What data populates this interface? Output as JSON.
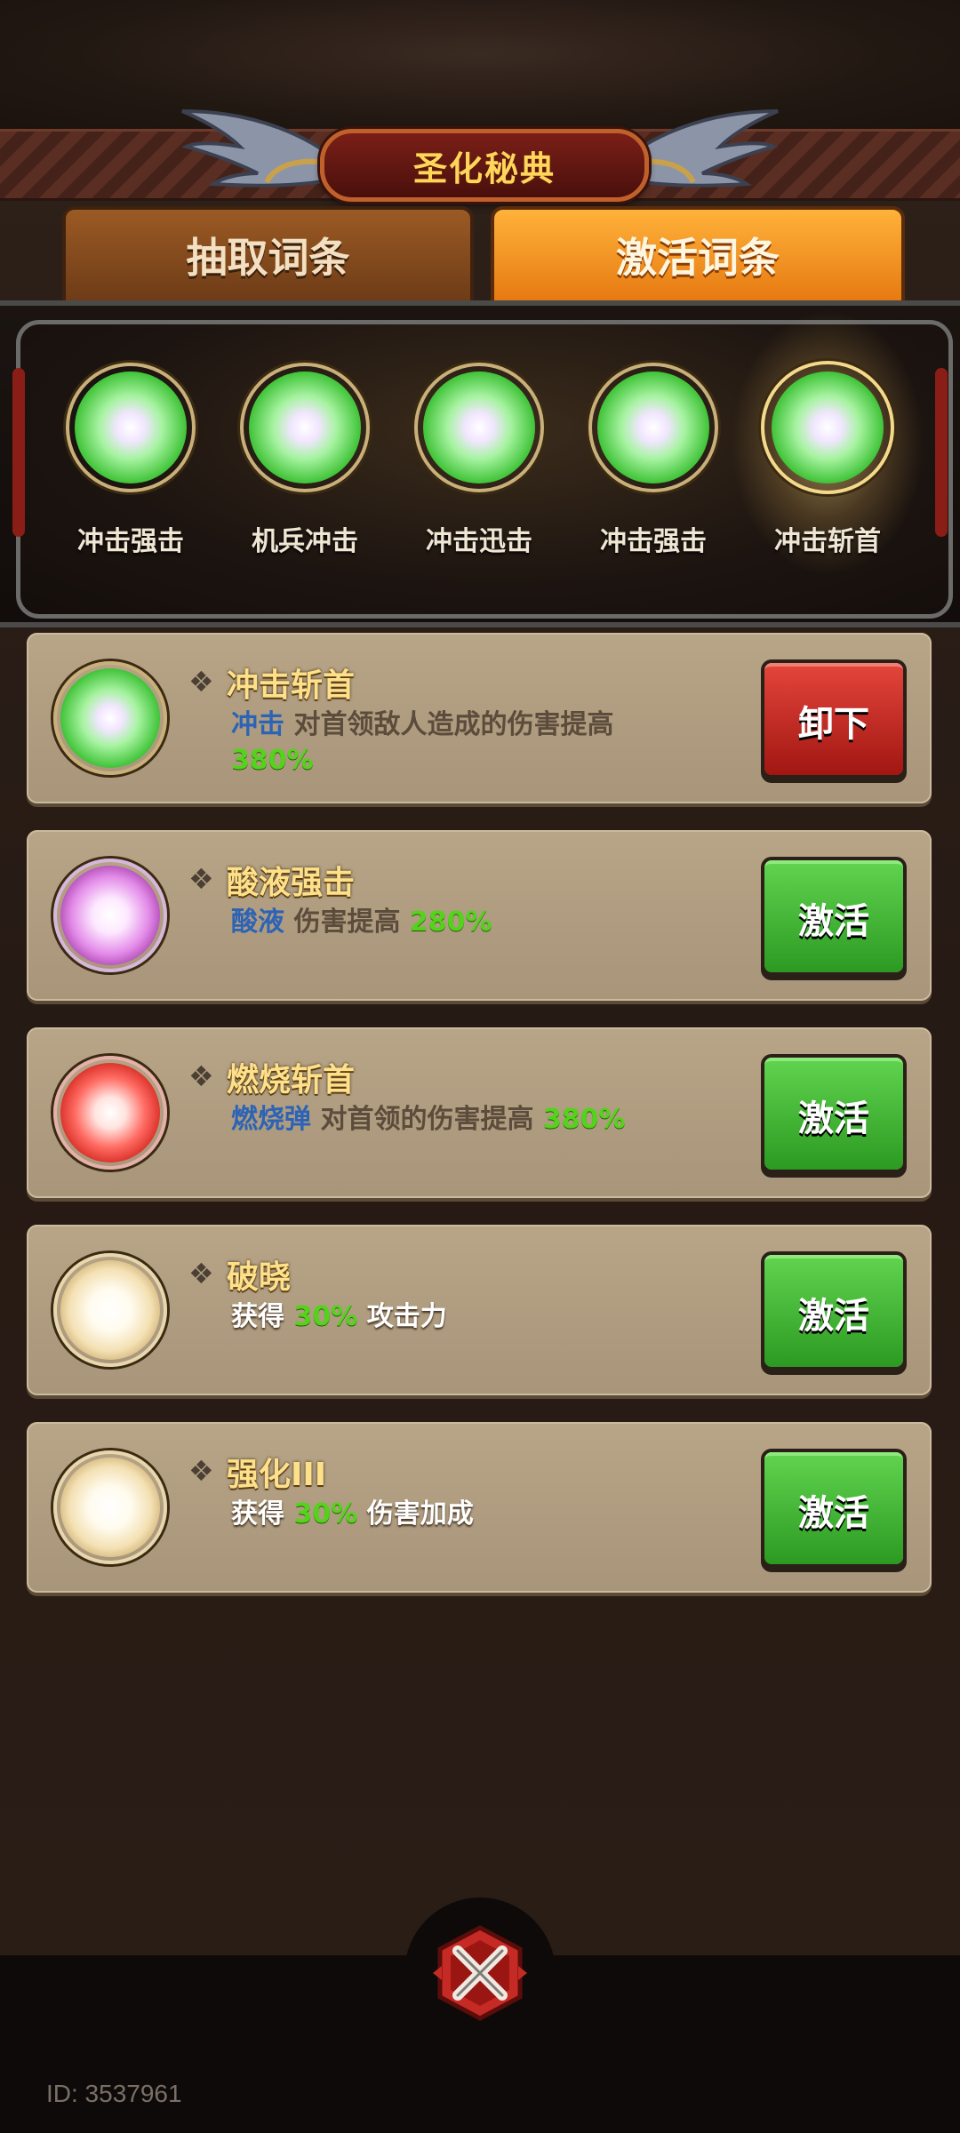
{
  "header": {
    "title": "圣化秘典"
  },
  "tabs": [
    {
      "label": "抽取词条",
      "active": false
    },
    {
      "label": "激活词条",
      "active": true
    }
  ],
  "equipped_slots": [
    {
      "name": "冲击强击",
      "orb_color": "green"
    },
    {
      "name": "机兵冲击",
      "orb_color": "green"
    },
    {
      "name": "冲击迅击",
      "orb_color": "green"
    },
    {
      "name": "冲击强击",
      "orb_color": "green"
    },
    {
      "name": "冲击斩首",
      "orb_color": "green",
      "selected": true
    }
  ],
  "entries": [
    {
      "title": "冲击斩首",
      "orb_color": "green",
      "desc_keyword": "冲击",
      "desc_text": "对首领敌人造成的伤害提高",
      "desc_value": "380%",
      "button": "卸下",
      "button_style": "red"
    },
    {
      "title": "酸液强击",
      "orb_color": "purple",
      "desc_keyword": "酸液",
      "desc_text": "伤害提高",
      "desc_value": "280%",
      "button": "激活",
      "button_style": "green"
    },
    {
      "title": "燃烧斩首",
      "orb_color": "red",
      "desc_keyword": "燃烧弹",
      "desc_text": "对首领的伤害提高",
      "desc_value": "380%",
      "button": "激活",
      "button_style": "green"
    },
    {
      "title": "破晓",
      "orb_color": "gold",
      "desc_prefix": "获得",
      "desc_value": "30%",
      "desc_suffix": "攻击力",
      "button": "激活",
      "button_style": "green"
    },
    {
      "title": "强化III",
      "orb_color": "gold",
      "desc_prefix": "获得",
      "desc_value": "30%",
      "desc_suffix": "伤害加成",
      "button": "激活",
      "button_style": "green"
    }
  ],
  "footer": {
    "uid": "ID: 3537961"
  },
  "colors": {
    "accent_orange": "#e67a12",
    "activate_green": "#2c9a22",
    "unequip_red": "#a21612",
    "title_gold": "#ffd55a"
  }
}
